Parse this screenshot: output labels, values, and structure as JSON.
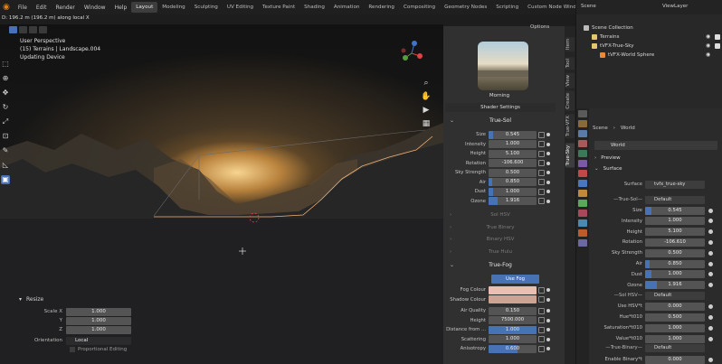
{
  "topbar": {
    "menus": [
      "File",
      "Edit",
      "Render",
      "Window",
      "Help"
    ],
    "workspaces": [
      "Layout",
      "Modeling",
      "Sculpting",
      "UV Editing",
      "Texture Paint",
      "Shading",
      "Animation",
      "Rendering",
      "Compositing",
      "Geometry Nodes",
      "Scripting",
      "Custom Node Window"
    ],
    "active_workspace": "Layout",
    "add_tab": "+"
  },
  "viewport": {
    "header_message": "D: 196.2 m (196.2 m) along local X",
    "info_line1": "User Perspective",
    "info_line2": "(15) Terrains | Landscape.004",
    "info_line3": "Updating Device",
    "colors": {
      "sun": "#ffd99a",
      "sky_glow": "#a06a30",
      "terrain": "#2a2a2a"
    }
  },
  "resize_panel": {
    "title": "Resize",
    "fields": [
      {
        "label": "Scale X",
        "value": "1.000"
      },
      {
        "label": "Y",
        "value": "1.000"
      },
      {
        "label": "Z",
        "value": "1.000"
      }
    ],
    "orientation_label": "Orientation",
    "orientation_value": "Local",
    "proportional_label": "Proportional Editing"
  },
  "npanel": {
    "options_label": "Options",
    "preset_name": "Morning",
    "shader_settings_label": "Shader Settings",
    "true_sol_title": "True-Sol",
    "true_sol_rows": [
      {
        "label": "Size",
        "value": "0.545",
        "fill": 0.1
      },
      {
        "label": "Intensity",
        "value": "1.000",
        "fill": 0.0
      },
      {
        "label": "Height",
        "value": "5.100",
        "fill": 0.0
      },
      {
        "label": "Rotation",
        "value": "-106.600",
        "fill": 0.0
      },
      {
        "label": "Sky Strength",
        "value": "0.500",
        "fill": 0.0
      },
      {
        "label": "Air",
        "value": "0.850",
        "fill": 0.08
      },
      {
        "label": "Dust",
        "value": "1.000",
        "fill": 0.1
      },
      {
        "label": "Ozone",
        "value": "1.916",
        "fill": 0.19
      }
    ],
    "collapsed_sections": [
      "Sol HSV",
      "True Binary",
      "Binary HSV",
      "True Hulu"
    ],
    "true_fog_title": "True-Fog",
    "use_fog_label": "Use Fog",
    "fog_rows": [
      {
        "label": "Fog Colour",
        "swatch": "#e8bfb0"
      },
      {
        "label": "Shadow Colour",
        "swatch": "#cda493"
      }
    ],
    "fog_value_rows": [
      {
        "label": "Air Quality",
        "value": "0.150",
        "fill": 0.0
      },
      {
        "label": "Height",
        "value": "7500.000",
        "fill": 0.0
      },
      {
        "label": "Distance from ...",
        "value": "1.000",
        "fill": 1.0
      },
      {
        "label": "Scattering",
        "value": "1.000",
        "fill": 0.0
      },
      {
        "label": "Anisotropy",
        "value": "0.600",
        "fill": 0.6
      }
    ]
  },
  "vtabs": [
    "Item",
    "Tool",
    "View",
    "Create",
    "True-VFX",
    "True-Sky"
  ],
  "vtabs_active": "True-Sky",
  "outliner": {
    "scene_label": "Scene",
    "view_layer_label": "ViewLayer",
    "items": [
      {
        "label": "Scene Collection",
        "indent": 0,
        "color": "#bbbbbb"
      },
      {
        "label": "Terrains",
        "indent": 1,
        "color": "#e6c66c"
      },
      {
        "label": "tVFX-True-Sky",
        "indent": 1,
        "color": "#e6c66c"
      },
      {
        "label": "tVFX-World Sphere",
        "indent": 2,
        "color": "#e88b39"
      }
    ]
  },
  "properties": {
    "breadcrumb_scene": "Scene",
    "breadcrumb_world": "World",
    "world_name": "World",
    "preview_label": "Preview",
    "surface_label": "Surface",
    "surface_field": "Surface",
    "surface_value": "tvfx_true-sky",
    "true_sol_group": "True-Sol",
    "true_sol_default": "Default",
    "rows": [
      {
        "label": "Size",
        "value": "0.545",
        "fill": 0.1
      },
      {
        "label": "Intensity",
        "value": "1.000",
        "fill": 0.0
      },
      {
        "label": "Height",
        "value": "5.100",
        "fill": 0.0
      },
      {
        "label": "Rotation",
        "value": "-106.610",
        "fill": 0.0
      },
      {
        "label": "Sky Strength",
        "value": "0.500",
        "fill": 0.0
      },
      {
        "label": "Air",
        "value": "0.850",
        "fill": 0.08
      },
      {
        "label": "Dust",
        "value": "1.000",
        "fill": 0.1
      },
      {
        "label": "Ozone",
        "value": "1.916",
        "fill": 0.19
      }
    ],
    "sol_hsv_group": "Sol HSV",
    "sol_hsv_default": "Default",
    "hsv_rows": [
      {
        "label": "Use HSV*t",
        "value": "0.000"
      },
      {
        "label": "Hue*t010",
        "value": "0.500"
      },
      {
        "label": "Saturation*t010",
        "value": "1.000"
      },
      {
        "label": "Value*t010",
        "value": "1.000"
      }
    ],
    "true_binary_group": "True-Binary",
    "true_binary_default": "Default",
    "enable_binary_label": "Enable Binary*t",
    "enable_binary_value": "0.000"
  }
}
